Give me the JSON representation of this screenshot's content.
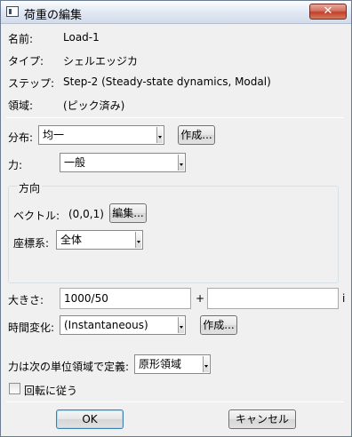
{
  "window": {
    "title": "荷重の編集",
    "close_label": "✕"
  },
  "info": {
    "name_label": "名前:",
    "name_value": "Load-1",
    "type_label": "タイプ:",
    "type_value": "シェルエッジカ",
    "step_label": "ステップ:",
    "step_value": "Step-2 (Steady-state dynamics, Modal)",
    "region_label": "領域:",
    "region_value": "(ピック済み)"
  },
  "distribution": {
    "label": "分布:",
    "value": "均一",
    "create_button": "作成..."
  },
  "force": {
    "label": "力:",
    "value": "一般"
  },
  "direction_group": {
    "title": "方向",
    "vector_label": "ベクトル:",
    "vector_value": "(0,0,1)",
    "edit_button": "編集...",
    "csys_label": "座標系:",
    "csys_value": "全体"
  },
  "magnitude": {
    "label": "大きさ:",
    "real_value": "1000/50",
    "plus": "+",
    "imag_value": "",
    "imag_unit": "i"
  },
  "time_variation": {
    "label": "時間変化:",
    "value": "(Instantaneous)",
    "create_button": "作成..."
  },
  "defined_per": {
    "label": "力は次の単位領域で定義:",
    "value": "原形領域"
  },
  "follow_rotation": {
    "label": "回転に従う",
    "checked": false
  },
  "footer": {
    "ok_label": "OK",
    "cancel_label": "キャンセル"
  }
}
